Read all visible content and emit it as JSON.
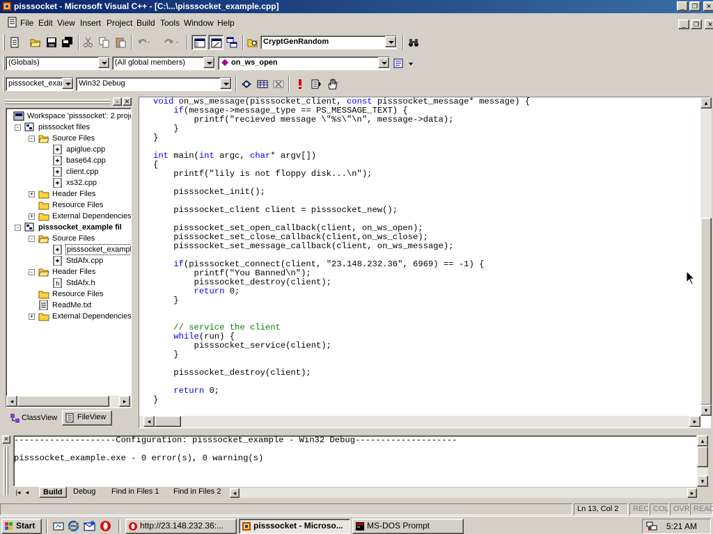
{
  "window": {
    "title": "pisssocket - Microsoft Visual C++ - [C:\\...\\pisssocket_example.cpp]"
  },
  "menu": [
    {
      "id": "file",
      "label": "File"
    },
    {
      "id": "edit",
      "label": "Edit"
    },
    {
      "id": "view",
      "label": "View"
    },
    {
      "id": "insert",
      "label": "Insert"
    },
    {
      "id": "project",
      "label": "Project"
    },
    {
      "id": "build",
      "label": "Build"
    },
    {
      "id": "tools",
      "label": "Tools"
    },
    {
      "id": "window",
      "label": "Window"
    },
    {
      "id": "help",
      "label": "Help"
    }
  ],
  "toolbar": {
    "find_combo": "CryptGenRandom",
    "scope_combo": "(Globals)",
    "members_combo": "(All global members)",
    "function_combo": "on_ws_open",
    "project_combo": "pisssocket_exan",
    "config_combo": "Win32 Debug"
  },
  "workspace": {
    "tree": [
      {
        "label": "Workspace 'pisssocket': 2 proje",
        "level": 0,
        "icon": "workspace-icon",
        "expander": ""
      },
      {
        "label": "pisssocket files",
        "level": 1,
        "icon": "project-icon",
        "expander": "-"
      },
      {
        "label": "Source Files",
        "level": 2,
        "icon": "folder-open-icon",
        "expander": "-"
      },
      {
        "label": "apiglue.cpp",
        "level": 3,
        "icon": "cpp-file-icon",
        "expander": ""
      },
      {
        "label": "base64.cpp",
        "level": 3,
        "icon": "cpp-file-icon",
        "expander": ""
      },
      {
        "label": "client.cpp",
        "level": 3,
        "icon": "cpp-file-icon",
        "expander": ""
      },
      {
        "label": "xs32.cpp",
        "level": 3,
        "icon": "cpp-file-icon",
        "expander": ""
      },
      {
        "label": "Header Files",
        "level": 2,
        "icon": "folder-icon",
        "expander": "+"
      },
      {
        "label": "Resource Files",
        "level": 2,
        "icon": "folder-icon",
        "expander": ""
      },
      {
        "label": "External Dependencies",
        "level": 2,
        "icon": "folder-icon",
        "expander": "+"
      },
      {
        "label": "pisssocket_example fil",
        "level": 1,
        "icon": "project-icon",
        "expander": "-",
        "bold": true
      },
      {
        "label": "Source Files",
        "level": 2,
        "icon": "folder-open-icon",
        "expander": "-"
      },
      {
        "label": "pisssocket_exampl",
        "level": 3,
        "icon": "cpp-file-icon",
        "expander": "",
        "selected": true
      },
      {
        "label": "StdAfx.cpp",
        "level": 3,
        "icon": "cpp-file-icon",
        "expander": ""
      },
      {
        "label": "Header Files",
        "level": 2,
        "icon": "folder-open-icon",
        "expander": "-"
      },
      {
        "label": "StdAfx.h",
        "level": 3,
        "icon": "h-file-icon",
        "expander": ""
      },
      {
        "label": "Resource Files",
        "level": 2,
        "icon": "folder-icon",
        "expander": ""
      },
      {
        "label": "ReadMe.txt",
        "level": 2,
        "icon": "text-file-icon",
        "expander": ""
      },
      {
        "label": "External Dependencies",
        "level": 2,
        "icon": "folder-icon",
        "expander": "+"
      }
    ],
    "tabs": [
      {
        "id": "classview",
        "label": "ClassView",
        "active": false
      },
      {
        "id": "fileview",
        "label": "FileView",
        "active": true
      }
    ]
  },
  "editor": {
    "lines": [
      [
        [
          "kw",
          "void"
        ],
        [
          "t",
          " on_ws_message(pisssocket_client, "
        ],
        [
          "kw",
          "const"
        ],
        [
          "t",
          " pisssocket_message* message) {"
        ]
      ],
      [
        [
          "t",
          "    "
        ],
        [
          "kw",
          "if"
        ],
        [
          "t",
          "(message->message_type == PS_MESSAGE_TEXT) {"
        ]
      ],
      [
        [
          "t",
          "        printf(\"recieved message \\\"%s\\\"\\n\", message->data);"
        ]
      ],
      [
        [
          "t",
          "    }"
        ]
      ],
      [
        [
          "t",
          "}"
        ]
      ],
      [
        [
          "t",
          ""
        ]
      ],
      [
        [
          "kw",
          "int"
        ],
        [
          "t",
          " main("
        ],
        [
          "kw",
          "int"
        ],
        [
          "t",
          " argc, "
        ],
        [
          "kw",
          "char"
        ],
        [
          "t",
          "* argv[])"
        ]
      ],
      [
        [
          "t",
          "{"
        ]
      ],
      [
        [
          "t",
          "    printf(\"lily is not floppy disk...\\n\");"
        ]
      ],
      [
        [
          "t",
          ""
        ]
      ],
      [
        [
          "t",
          "    pisssocket_init();"
        ]
      ],
      [
        [
          "t",
          ""
        ]
      ],
      [
        [
          "t",
          "    pisssocket_client client = pisssocket_new();"
        ]
      ],
      [
        [
          "t",
          ""
        ]
      ],
      [
        [
          "t",
          "    pisssocket_set_open_callback(client, on_ws_open);"
        ]
      ],
      [
        [
          "t",
          "    pisssocket_set_close_callback(client,on_ws_close);"
        ]
      ],
      [
        [
          "t",
          "    pisssocket_set_message_callback(client, on_ws_message);"
        ]
      ],
      [
        [
          "t",
          ""
        ]
      ],
      [
        [
          "t",
          "    "
        ],
        [
          "kw",
          "if"
        ],
        [
          "t",
          "(pisssocket_connect(client, \"23.148.232.36\", 6969) == -1) {"
        ]
      ],
      [
        [
          "t",
          "        printf(\"You Banned\\n\");"
        ]
      ],
      [
        [
          "t",
          "        pisssocket_destroy(client);"
        ]
      ],
      [
        [
          "t",
          "        "
        ],
        [
          "kw",
          "return"
        ],
        [
          "t",
          " 0;"
        ]
      ],
      [
        [
          "t",
          "    }"
        ]
      ],
      [
        [
          "t",
          ""
        ]
      ],
      [
        [
          "t",
          ""
        ]
      ],
      [
        [
          "t",
          "    "
        ],
        [
          "cm",
          "// service the client"
        ]
      ],
      [
        [
          "t",
          "    "
        ],
        [
          "kw",
          "while"
        ],
        [
          "t",
          "(run) {"
        ]
      ],
      [
        [
          "t",
          "        pisssocket_service(client);"
        ]
      ],
      [
        [
          "t",
          "    }"
        ]
      ],
      [
        [
          "t",
          ""
        ]
      ],
      [
        [
          "t",
          "    pisssocket_destroy(client);"
        ]
      ],
      [
        [
          "t",
          ""
        ]
      ],
      [
        [
          "t",
          "    "
        ],
        [
          "kw",
          "return"
        ],
        [
          "t",
          " 0;"
        ]
      ],
      [
        [
          "t",
          "}"
        ]
      ]
    ]
  },
  "output": {
    "lines": [
      "--------------------Configuration: pisssocket_example - Win32 Debug--------------------",
      "",
      "pisssocket_example.exe - 0 error(s), 0 warning(s)"
    ],
    "tabs": [
      {
        "id": "build",
        "label": "Build",
        "active": true
      },
      {
        "id": "debug",
        "label": "Debug",
        "active": false
      },
      {
        "id": "find1",
        "label": "Find in Files 1",
        "active": false
      },
      {
        "id": "find2",
        "label": "Find in Files 2",
        "active": false
      }
    ]
  },
  "status": {
    "position": "Ln 13, Col 2",
    "indicators": [
      "REC",
      "COL",
      "OVR",
      "READ"
    ]
  },
  "taskbar": {
    "start_label": "Start",
    "tasks": [
      {
        "id": "browser",
        "label": "http://23.148.232.36:...",
        "active": false
      },
      {
        "id": "msvc",
        "label": "pisssocket - Microso...",
        "active": true
      },
      {
        "id": "dos",
        "label": "MS-DOS Prompt",
        "active": false
      }
    ],
    "clock": "5:21 AM"
  },
  "colors": {
    "titlebar_start": "#0a246a",
    "titlebar_end": "#3a6ea5",
    "keyword": "#0000ff",
    "comment": "#008000",
    "face": "#d4d0c8"
  }
}
